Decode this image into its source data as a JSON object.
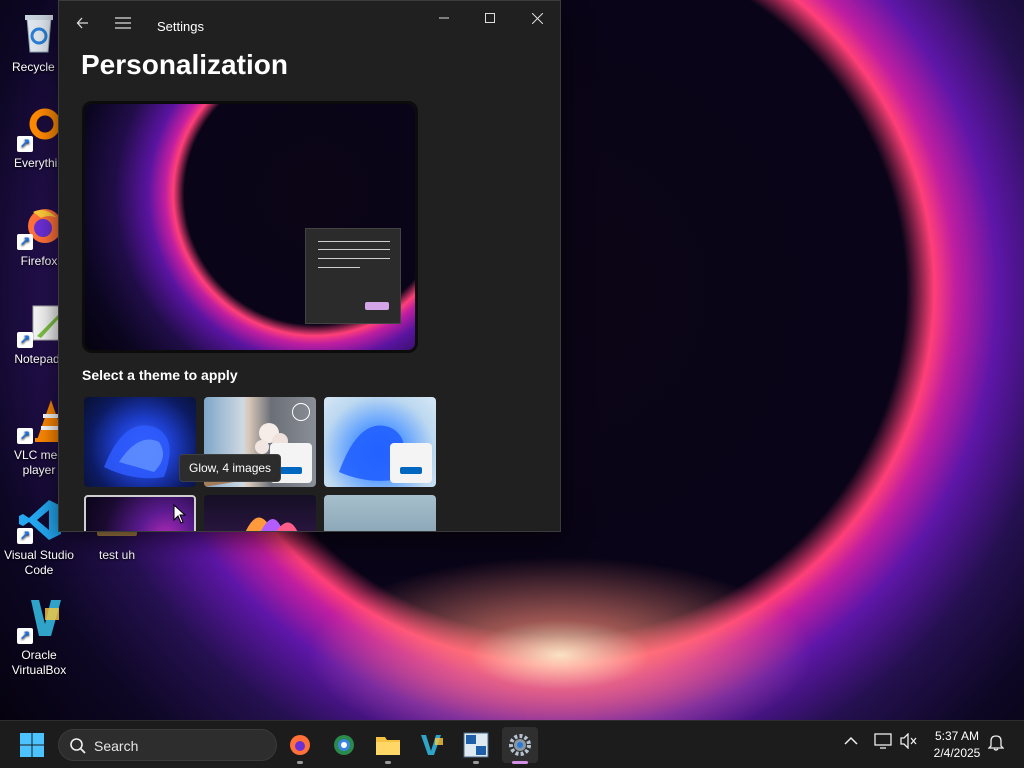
{
  "desktop": {
    "icons": [
      {
        "label_line1": "Recycle B",
        "label_line2": ""
      },
      {
        "label_line1": "Everythin",
        "label_line2": ""
      },
      {
        "label_line1": "Firefox",
        "label_line2": ""
      },
      {
        "label_line1": "Notepad-",
        "label_line2": ""
      },
      {
        "label_line1": "VLC med",
        "label_line2": "player"
      },
      {
        "label_line1": "Visual Studio",
        "label_line2": "Code"
      },
      {
        "label_line1": "Oracle",
        "label_line2": "VirtualBox"
      }
    ],
    "partial_icon_label": "test uh"
  },
  "settings": {
    "window_title": "Settings",
    "page_title": "Personalization",
    "theme_heading": "Select a theme to apply",
    "tooltip": "Glow, 4 images"
  },
  "taskbar": {
    "search_placeholder": "Search",
    "time": "5:37 AM",
    "date": "2/4/2025",
    "accent_color": "#d38fe6"
  },
  "colors": {
    "window_bg": "#202020",
    "taskbar_bg": "#1c1c1c",
    "button_blue": "#0067c0"
  }
}
